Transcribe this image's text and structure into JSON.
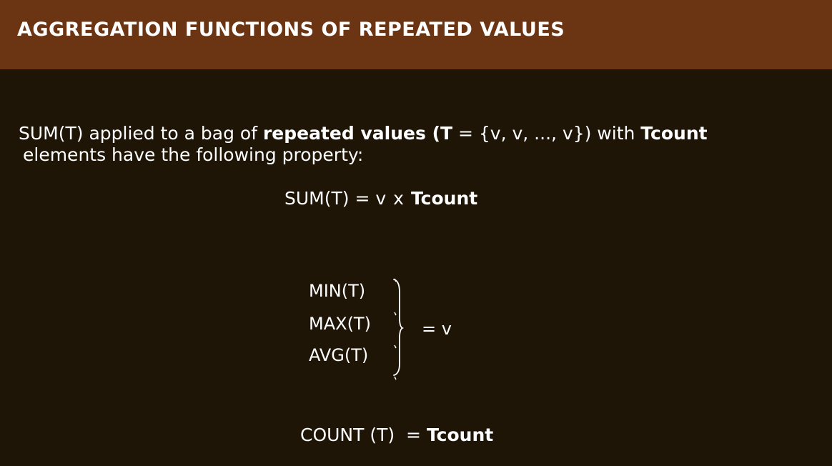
{
  "header": {
    "title": "AGGREGATION FUNCTIONS OF REPEATED VALUES"
  },
  "body": {
    "para_p1": "SUM(T) applied to a bag of ",
    "para_b1": "repeated values",
    "para_b2": " (T",
    "para_p2": " = {v, v, ..., v}) with ",
    "para_b3": "Tcount",
    "para_line2": "elements have the following property:",
    "formula_lhs": "SUM(T) = v",
    "formula_op": "x",
    "formula_rhs": "Tcount",
    "fn_min": "MIN(T)",
    "fn_max": "MAX(T)",
    "fn_avg": "AVG(T)",
    "equals_v": "=  v",
    "count_lhs": "COUNT (T)",
    "count_eq": "=",
    "count_rhs": "Tcount"
  }
}
